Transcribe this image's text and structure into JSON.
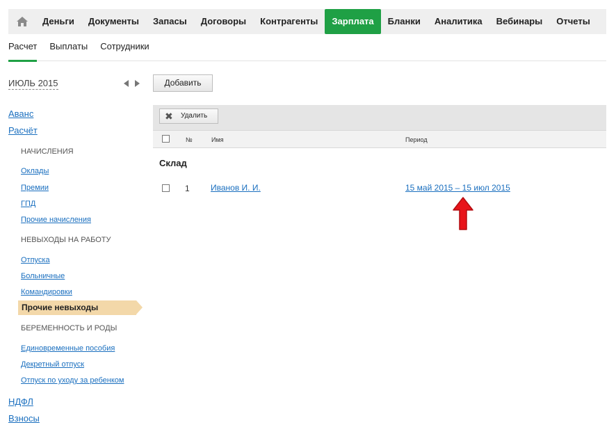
{
  "nav": {
    "items": [
      "Деньги",
      "Документы",
      "Запасы",
      "Договоры",
      "Контрагенты",
      "Зарплата",
      "Бланки",
      "Аналитика",
      "Вебинары",
      "Отчеты"
    ],
    "active": "Зарплата"
  },
  "subtabs": [
    "Расчет",
    "Выплаты",
    "Сотрудники"
  ],
  "sidebar": {
    "month": "ИЮЛЬ 2015",
    "top_links": [
      "Аванс",
      "Расчёт"
    ],
    "section_accruals": "НАЧИСЛЕНИЯ",
    "accrual_links": [
      "Оклады",
      "Премии",
      "ГПД",
      "Прочие начисления"
    ],
    "section_absence": "НЕВЫХОДЫ НА РАБОТУ",
    "absence_links": [
      "Отпуска",
      "Больничные",
      "Командировки"
    ],
    "active_item": "Прочие невыходы",
    "section_pregnancy": "БЕРЕМЕННОСТЬ И РОДЫ",
    "pregnancy_links": [
      "Единовременные пособия",
      "Декретный отпуск",
      "Отпуск по уходу за ребенком"
    ],
    "bottom_links": [
      "НДФЛ",
      "Взносы"
    ]
  },
  "main": {
    "add_label": "Добавить",
    "delete_label": "Удалить",
    "columns": {
      "num": "№",
      "name": "Имя",
      "period": "Период"
    },
    "group": "Склад",
    "rows": [
      {
        "num": "1",
        "name": "Иванов И. И.",
        "period": "15 май 2015 – 15 июл 2015"
      }
    ]
  },
  "colors": {
    "accent": "#1fa045",
    "link": "#1a6fbf",
    "active_bg": "#f3d8a9",
    "annotation": "#e8141a"
  }
}
